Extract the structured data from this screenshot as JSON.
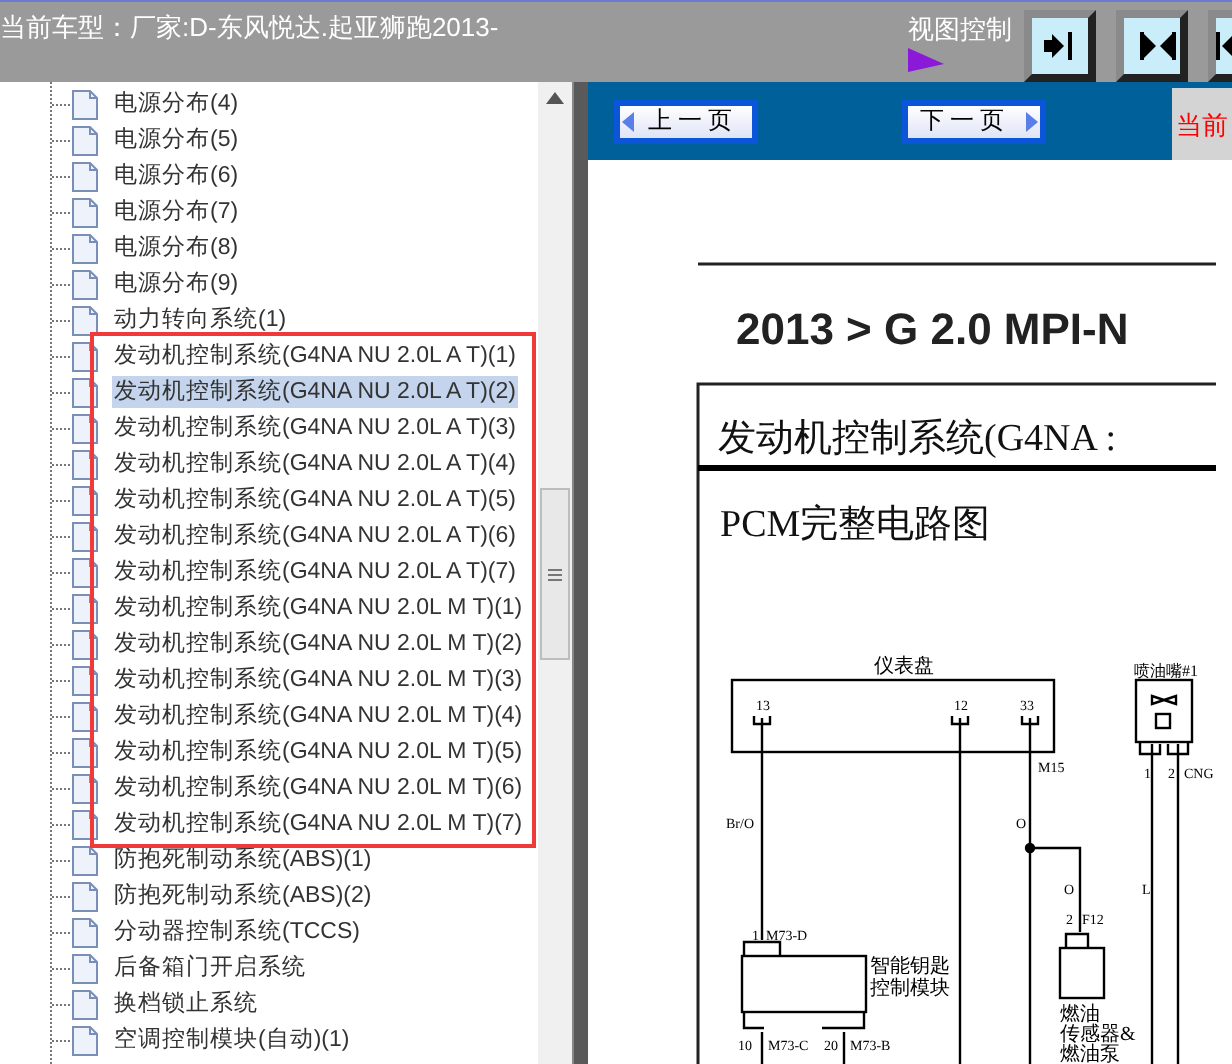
{
  "header": {
    "title": "当前车型：厂家:D-东风悦达.起亚狮跑2013-",
    "view_control": "视图控制"
  },
  "view_buttons": [
    {
      "kind": "right"
    },
    {
      "kind": "center"
    },
    {
      "kind": "left"
    }
  ],
  "tree": {
    "items": [
      {
        "kind": "item",
        "label": "电源分布(4)",
        "selected": false
      },
      {
        "kind": "item",
        "label": "电源分布(5)",
        "selected": false
      },
      {
        "kind": "item",
        "label": "电源分布(6)",
        "selected": false
      },
      {
        "kind": "item",
        "label": "电源分布(7)",
        "selected": false
      },
      {
        "kind": "item",
        "label": "电源分布(8)",
        "selected": false
      },
      {
        "kind": "item",
        "label": "电源分布(9)",
        "selected": false
      },
      {
        "kind": "item",
        "label": "动力转向系统(1)",
        "selected": false
      },
      {
        "kind": "frame",
        "items": [
          {
            "label": "发动机控制系统(G4NA NU 2.0L A T)(1)",
            "selected": false
          },
          {
            "label": "发动机控制系统(G4NA NU 2.0L A T)(2)",
            "selected": true
          },
          {
            "label": "发动机控制系统(G4NA NU 2.0L A T)(3)",
            "selected": false
          },
          {
            "label": "发动机控制系统(G4NA NU 2.0L A T)(4)",
            "selected": false
          },
          {
            "label": "发动机控制系统(G4NA NU 2.0L A T)(5)",
            "selected": false
          },
          {
            "label": "发动机控制系统(G4NA NU 2.0L A T)(6)",
            "selected": false
          },
          {
            "label": "发动机控制系统(G4NA NU 2.0L A T)(7)",
            "selected": false
          },
          {
            "label": "发动机控制系统(G4NA NU 2.0L M T)(1)",
            "selected": false
          },
          {
            "label": "发动机控制系统(G4NA NU 2.0L M T)(2)",
            "selected": false
          },
          {
            "label": "发动机控制系统(G4NA NU 2.0L M T)(3)",
            "selected": false
          },
          {
            "label": "发动机控制系统(G4NA NU 2.0L M T)(4)",
            "selected": false
          },
          {
            "label": "发动机控制系统(G4NA NU 2.0L M T)(5)",
            "selected": false
          },
          {
            "label": "发动机控制系统(G4NA NU 2.0L M T)(6)",
            "selected": false
          },
          {
            "label": "发动机控制系统(G4NA NU 2.0L M T)(7)",
            "selected": false
          }
        ]
      },
      {
        "kind": "item",
        "label": "防抱死制动系统(ABS)(1)",
        "selected": false
      },
      {
        "kind": "item",
        "label": "防抱死制动系统(ABS)(2)",
        "selected": false
      },
      {
        "kind": "item",
        "label": "分动器控制系统(TCCS)",
        "selected": false
      },
      {
        "kind": "item",
        "label": "后备箱门开启系统",
        "selected": false
      },
      {
        "kind": "item",
        "label": "换档锁止系统",
        "selected": false
      },
      {
        "kind": "item",
        "label": "空调控制模块(自动)(1)",
        "selected": false
      }
    ]
  },
  "toolbar": {
    "prev": "上一页",
    "next": "下一页",
    "current": "当前"
  },
  "document": {
    "heading": "2013 > G 2.0 MPI-N",
    "section": "发动机控制系统(G4NA :",
    "subtitle": "PCM完整电路图",
    "diagram_labels": [
      "仪表盘",
      "13",
      "12",
      "33",
      "M15",
      "Br/O",
      "O",
      "O",
      "L",
      "1",
      "M73-D",
      "智能钥匙",
      "控制模块",
      "10",
      "M73-C",
      "20",
      "M73-B",
      "2",
      "F12",
      "燃油",
      "传感器&",
      "燃油泵",
      "喷油嘴#1",
      "1",
      "2",
      "CNG"
    ]
  }
}
